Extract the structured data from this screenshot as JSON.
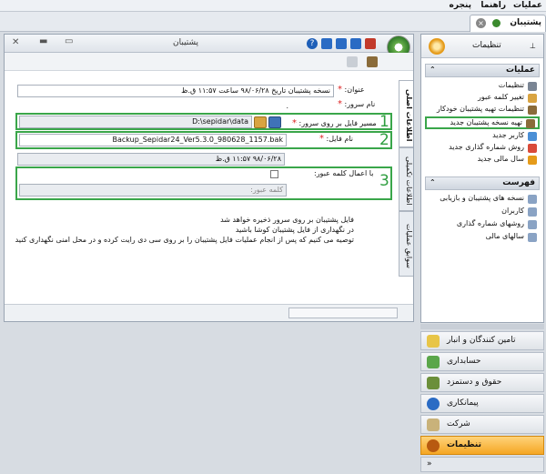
{
  "menu": {
    "items": [
      "عملیات",
      "راهنما",
      "پنجره"
    ]
  },
  "document_tab": {
    "label": "پشتیبان"
  },
  "window": {
    "title": "پشتیبان",
    "form": {
      "title_label": "عنوان:",
      "title_value": "نسخه پشتیبان تاریخ ۹۸/۰۶/۲۸ ساعت ۱۱:۵۷ ق.ظ",
      "server_label": "نام سرور:",
      "server_value": ".",
      "path_label": "مسیر فایل بر روی سرور:",
      "path_value": "D:\\sepidar\\data",
      "filename_label": "نام فایل:",
      "filename_value": "Backup_Sepidar24_Ver5.3.0_980628_1157.bak",
      "datetime_value": "۹۸/۰۶/۲۸ ۱۱:۵۷ ق.ظ",
      "password_checkbox_label": "با اعمال کلمه عبور:",
      "password_placeholder": "کلمه عبور:",
      "notes": [
        "فایل پشتیبان بر روی سرور ذخیره خواهد شد",
        "در نگهداری از فایل پشتیبان کوشا باشید",
        "توصیه می کنیم که پس از انجام عملیات فایل پشتیبان را بر روی سی دی رایت کرده و در محل امنی نگهداری کنید"
      ]
    },
    "tabs": [
      "اطلاعات اصلی",
      "اطلاعات تکمیلی",
      "سوابق عملیات"
    ],
    "annotation_numbers": [
      "1",
      "2",
      "3"
    ]
  },
  "right_panel": {
    "title": "تنظیمات",
    "sections": [
      {
        "title": "عملیات",
        "items": [
          "تنظیمات",
          "تغییر کلمه عبور",
          "تنظیمات تهیه پشتیبان خودکار",
          "تهیه نسخه پشتیبان جدید",
          "کاربر جدید",
          "روش شماره گذاری جدید",
          "سال مالی جدید"
        ]
      },
      {
        "title": "فهرست",
        "items": [
          "نسخه های پشتیبان و بازیابی",
          "کاربران",
          "روشهای شماره گذاری",
          "سالهای مالی"
        ]
      }
    ]
  },
  "bottom_nav": {
    "items": [
      "تامین کنندگان و انبار",
      "حسابداری",
      "حقوق و دستمزد",
      "پیمانکاری",
      "شرکت",
      "تنظیمات"
    ],
    "active": "تنظیمات"
  },
  "colors": {
    "annotation_green": "#3aa64a",
    "active_nav": "#f5a623",
    "required_star": "#dd2222"
  }
}
